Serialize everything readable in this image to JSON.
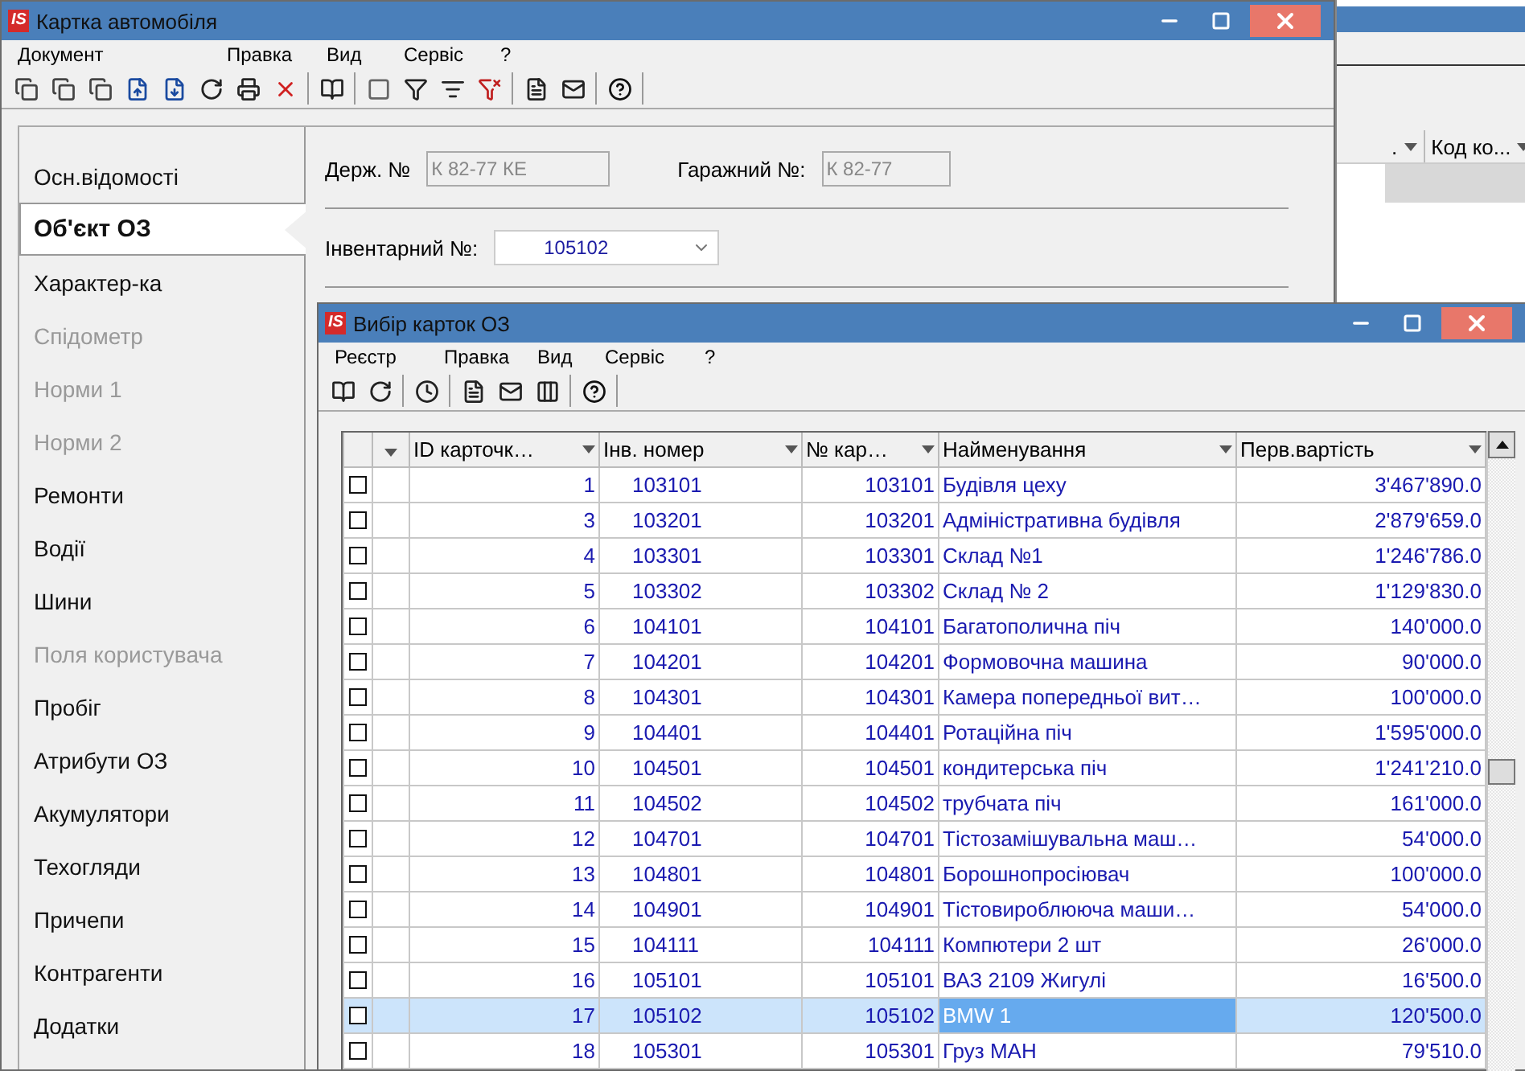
{
  "background_window": {
    "columns": [
      ".",
      "Код ко..."
    ]
  },
  "main_window": {
    "logo": "IS",
    "title": "Картка автомобіля",
    "menu": [
      "Документ",
      "Правка",
      "Вид",
      "Сервіс",
      "?"
    ]
  },
  "sidebar": {
    "items": [
      {
        "label": "Осн.відомості",
        "selected": false,
        "disabled": false
      },
      {
        "label": "Об'єкт ОЗ",
        "selected": true,
        "disabled": false
      },
      {
        "label": "Характер-ка",
        "selected": false,
        "disabled": false
      },
      {
        "label": "Спідометр",
        "selected": false,
        "disabled": true
      },
      {
        "label": "Норми 1",
        "selected": false,
        "disabled": true
      },
      {
        "label": "Норми 2",
        "selected": false,
        "disabled": true
      },
      {
        "label": "Ремонти",
        "selected": false,
        "disabled": false
      },
      {
        "label": "Водії",
        "selected": false,
        "disabled": false
      },
      {
        "label": "Шини",
        "selected": false,
        "disabled": false
      },
      {
        "label": "Поля користувача",
        "selected": false,
        "disabled": true
      },
      {
        "label": "Пробіг",
        "selected": false,
        "disabled": false
      },
      {
        "label": "Атрибути ОЗ",
        "selected": false,
        "disabled": false
      },
      {
        "label": "Акумулятори",
        "selected": false,
        "disabled": false
      },
      {
        "label": "Техогляди",
        "selected": false,
        "disabled": false
      },
      {
        "label": "Причепи",
        "selected": false,
        "disabled": false
      },
      {
        "label": "Контрагенти",
        "selected": false,
        "disabled": false
      },
      {
        "label": "Додатки",
        "selected": false,
        "disabled": false
      }
    ]
  },
  "form": {
    "state_no": {
      "label": "Держ. №",
      "value": "К 82-77 КЕ",
      "disabled": true
    },
    "garage_no": {
      "label": "Гаражний №:",
      "value": "К 82-77",
      "disabled": true
    },
    "inventory_no": {
      "label": "Інвентарний №:",
      "value": "105102"
    }
  },
  "dialog": {
    "logo": "IS",
    "title": "Вибір карток ОЗ",
    "menu": [
      "Реєстр",
      "Правка",
      "Вид",
      "Сервіс",
      "?"
    ],
    "table": {
      "columns": [
        "ID карточк…",
        "Інв. номер",
        "№ кар…",
        "Найменування",
        "Перв.вартість"
      ],
      "rows": [
        {
          "id": "1",
          "inv": "103101",
          "card": "103101",
          "name": "Будівля цеху",
          "cost": "3'467'890.0",
          "checked": false,
          "selected": false
        },
        {
          "id": "3",
          "inv": "103201",
          "card": "103201",
          "name": "Адміністративна будівля",
          "cost": "2'879'659.0",
          "checked": false,
          "selected": false
        },
        {
          "id": "4",
          "inv": "103301",
          "card": "103301",
          "name": "Склад №1",
          "cost": "1'246'786.0",
          "checked": false,
          "selected": false
        },
        {
          "id": "5",
          "inv": "103302",
          "card": "103302",
          "name": "Склад № 2",
          "cost": "1'129'830.0",
          "checked": false,
          "selected": false
        },
        {
          "id": "6",
          "inv": "104101",
          "card": "104101",
          "name": "Багатополична піч",
          "cost": "140'000.0",
          "checked": false,
          "selected": false
        },
        {
          "id": "7",
          "inv": "104201",
          "card": "104201",
          "name": "Формовочна машина",
          "cost": "90'000.0",
          "checked": false,
          "selected": false
        },
        {
          "id": "8",
          "inv": "104301",
          "card": "104301",
          "name": "Камера попередньої вит…",
          "cost": "100'000.0",
          "checked": false,
          "selected": false
        },
        {
          "id": "9",
          "inv": "104401",
          "card": "104401",
          "name": "Ротаційна піч",
          "cost": "1'595'000.0",
          "checked": false,
          "selected": false
        },
        {
          "id": "10",
          "inv": "104501",
          "card": "104501",
          "name": "кондитерська піч",
          "cost": "1'241'210.0",
          "checked": false,
          "selected": false
        },
        {
          "id": "11",
          "inv": "104502",
          "card": "104502",
          "name": "трубчата піч",
          "cost": "161'000.0",
          "checked": false,
          "selected": false
        },
        {
          "id": "12",
          "inv": "104701",
          "card": "104701",
          "name": "Тістозамішувальна маш…",
          "cost": "54'000.0",
          "checked": false,
          "selected": false
        },
        {
          "id": "13",
          "inv": "104801",
          "card": "104801",
          "name": "Борошнопросіювач",
          "cost": "100'000.0",
          "checked": false,
          "selected": false
        },
        {
          "id": "14",
          "inv": "104901",
          "card": "104901",
          "name": "Тістовироблююча маши…",
          "cost": "54'000.0",
          "checked": false,
          "selected": false
        },
        {
          "id": "15",
          "inv": "104111",
          "card": "104111",
          "name": "Компютери 2 шт",
          "cost": "26'000.0",
          "checked": false,
          "selected": false
        },
        {
          "id": "16",
          "inv": "105101",
          "card": "105101",
          "name": "ВАЗ 2109 Жигулі",
          "cost": "16'500.0",
          "checked": false,
          "selected": false
        },
        {
          "id": "17",
          "inv": "105102",
          "card": "105102",
          "name": "BMW 1",
          "cost": "120'500.0",
          "checked": false,
          "selected": true
        },
        {
          "id": "18",
          "inv": "105301",
          "card": "105301",
          "name": "Груз МАН",
          "cost": "79'510.0",
          "checked": false,
          "selected": false
        }
      ]
    }
  }
}
